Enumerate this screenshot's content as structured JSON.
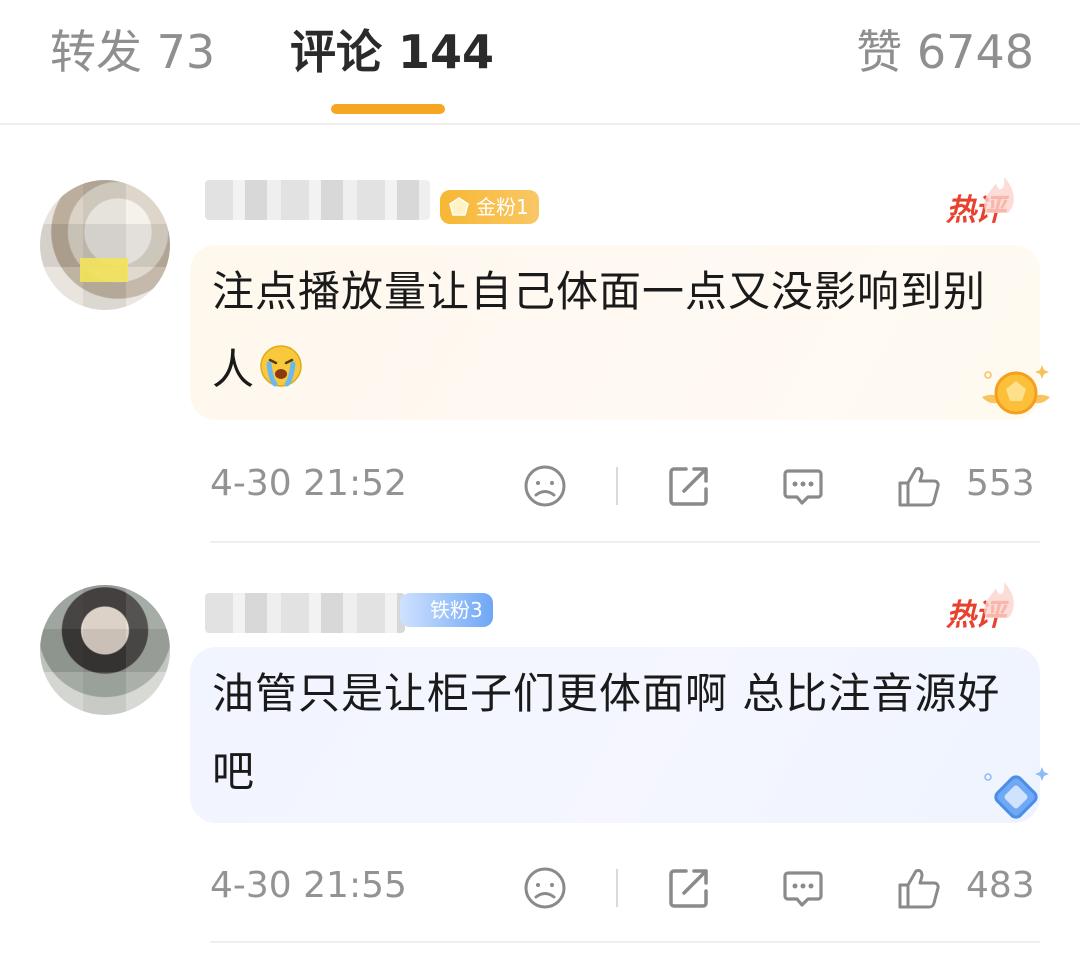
{
  "tabs": {
    "repost": "转发 73",
    "comments": "评论 144",
    "likes": "赞 6748"
  },
  "colors": {
    "accent": "#f5a623",
    "hot": "#e8422f",
    "gold_badge": "#f7b733",
    "iron_badge": "#6ea6f5",
    "meta_text": "#939393"
  },
  "comments": [
    {
      "badge": "金粉1",
      "hot_label": "热评",
      "text": "注点播放量让自己体面一点又没影响到别人",
      "emoji": "crying-face-emoji",
      "time": "4-30 21:52",
      "likes": "553"
    },
    {
      "badge": "铁粉3",
      "hot_label": "热评",
      "text": "油管只是让柜子们更体面啊 总比注音源好吧",
      "time": "4-30 21:55",
      "likes": "483"
    }
  ],
  "icons": [
    "dislike-icon",
    "share-icon",
    "comment-icon",
    "like-icon"
  ]
}
